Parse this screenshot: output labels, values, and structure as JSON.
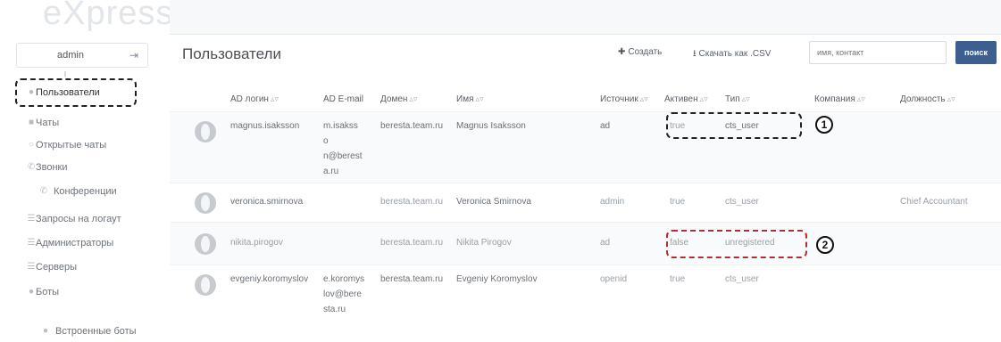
{
  "sidebar": {
    "logo": "eXpress",
    "user": "admin",
    "items": [
      {
        "label": "Пользователи",
        "icon": "user-icon"
      },
      {
        "label": "Чаты",
        "icon": "chat-icon"
      },
      {
        "label": "Открытые чаты",
        "icon": "open-chat-icon"
      },
      {
        "label": "Звонки",
        "icon": "phone-icon"
      },
      {
        "label": "Конференции",
        "icon": "phone-icon"
      },
      {
        "label": "Запросы на логаут",
        "icon": "list-icon"
      },
      {
        "label": "Администраторы",
        "icon": "list-icon"
      },
      {
        "label": "Серверы",
        "icon": "server-icon"
      },
      {
        "label": "Боты",
        "icon": "bot-icon"
      },
      {
        "label": "Встроенные боты",
        "icon": "bot-icon"
      }
    ]
  },
  "header": {
    "title": "Пользователи",
    "create_label": "Создать",
    "download_label": "Скачать как .CSV",
    "search_placeholder": "имя, контакт",
    "search_button": "поиск"
  },
  "table": {
    "columns": [
      "AD логин",
      "AD E-mail",
      "Домен",
      "Имя",
      "Источник",
      "Активен",
      "Тип",
      "Компания",
      "Должность"
    ],
    "rows": [
      {
        "login": "magnus.isaksson",
        "email": "m.isakss\no\nn@berest\na.ru",
        "domain": "beresta.team.ru",
        "name": "Magnus Isaksson",
        "source": "ad",
        "active": "true",
        "type": "cts_user",
        "company": "",
        "position": ""
      },
      {
        "login": "veronica.smirnova",
        "email": "",
        "domain": "beresta.team.ru",
        "name": "Veronica Smirnova",
        "source": "admin",
        "active": "true",
        "type": "cts_user",
        "company": "",
        "position": "Chief Accountant"
      },
      {
        "login": "nikita.pirogov",
        "email": "",
        "domain": "beresta.team.ru",
        "name": "Nikita Pirogov",
        "source": "ad",
        "active": "false",
        "type": "unregistered",
        "company": "",
        "position": ""
      },
      {
        "login": "evgeniy.koromyslov",
        "email": "e.koromys\nlov@bere\nsta.ru",
        "domain": "beresta.team.ru",
        "name": "Evgeniy Koromyslov",
        "source": "openid",
        "active": "true",
        "type": "cts_user",
        "company": "",
        "position": ""
      }
    ]
  },
  "annotations": [
    "1",
    "2"
  ],
  "colors": {
    "accent": "#3d5f8f",
    "highlight_black": "#222222",
    "highlight_red": "#b03030"
  }
}
